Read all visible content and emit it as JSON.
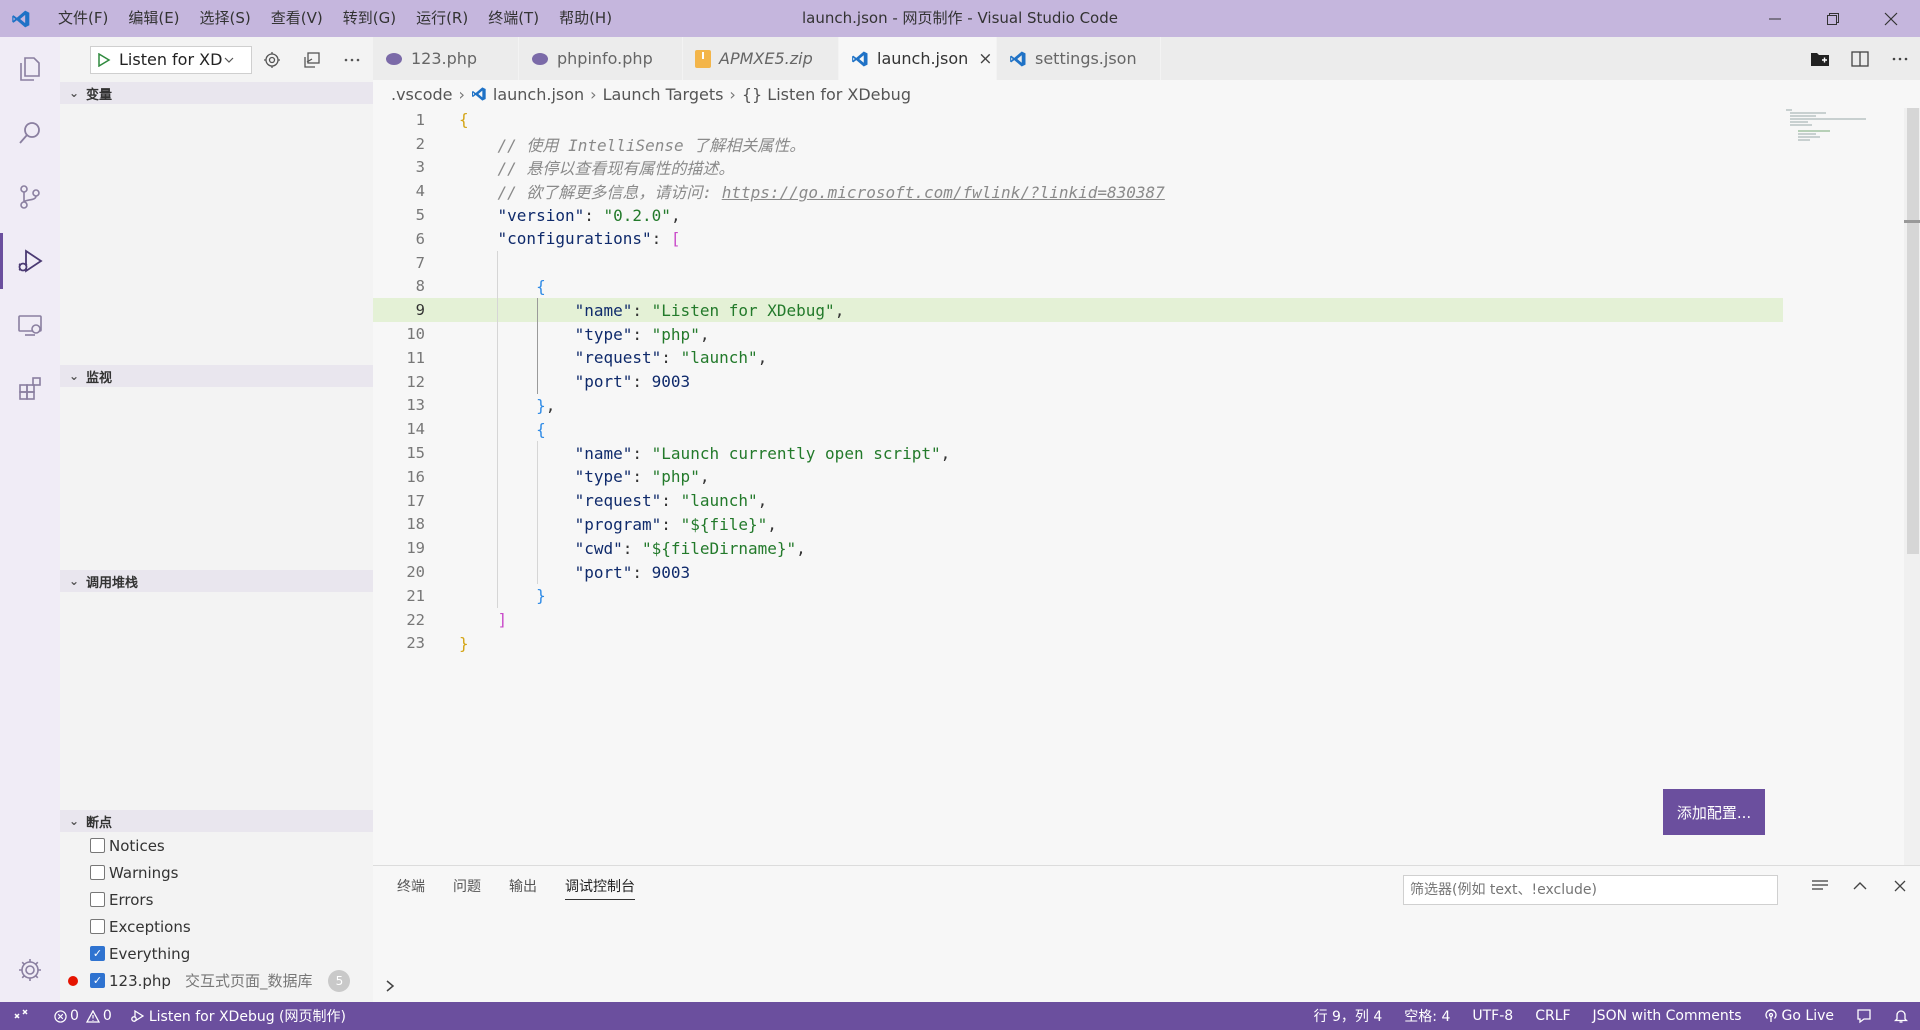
{
  "titlebar": {
    "menus": [
      "文件(F)",
      "编辑(E)",
      "选择(S)",
      "查看(V)",
      "转到(G)",
      "运行(R)",
      "终端(T)",
      "帮助(H)"
    ],
    "window_title": "launch.json - 网页制作 - Visual Studio Code"
  },
  "activitybar": {
    "icons": [
      "explorer-icon",
      "search-icon",
      "source-control-icon",
      "run-debug-icon",
      "remote-explorer-icon",
      "extensions-icon"
    ],
    "active": "run-debug-icon",
    "bottom": "settings-gear-icon"
  },
  "debug_toolbar": {
    "config_label": "Listen for XDe"
  },
  "sidebar": {
    "variables_header": "变量",
    "watch_header": "监视",
    "callstack_header": "调用堆栈",
    "breakpoints_header": "断点",
    "breakpoints": [
      {
        "label": "Notices",
        "checked": false
      },
      {
        "label": "Warnings",
        "checked": false
      },
      {
        "label": "Errors",
        "checked": false
      },
      {
        "label": "Exceptions",
        "checked": false
      },
      {
        "label": "Everything",
        "checked": true
      }
    ],
    "file_breakpoint": {
      "file": "123.php",
      "description": "交互式页面_数据库",
      "count": "5"
    }
  },
  "tabs": [
    {
      "label": "123.php",
      "icon": "php-elephant-icon",
      "active": false
    },
    {
      "label": "phpinfo.php",
      "icon": "php-elephant-icon",
      "active": false
    },
    {
      "label": "APMXE5.zip",
      "icon": "zip-icon",
      "active": false
    },
    {
      "label": "launch.json",
      "icon": "vscode-icon",
      "active": true
    },
    {
      "label": "settings.json",
      "icon": "vscode-icon",
      "active": false
    }
  ],
  "breadcrumb": {
    "folder": ".vscode",
    "file": "launch.json",
    "node1": "Launch Targets",
    "node2": "{} Listen for XDebug"
  },
  "editor": {
    "current_line": 9,
    "lines": [
      "{",
      "    // 使用 IntelliSense 了解相关属性。",
      "    // 悬停以查看现有属性的描述。",
      "    // 欲了解更多信息，请访问: https://go.microsoft.com/fwlink/?linkid=830387",
      "    \"version\": \"0.2.0\",",
      "    \"configurations\": [",
      "",
      "        {",
      "            \"name\": \"Listen for XDebug\",",
      "            \"type\": \"php\",",
      "            \"request\": \"launch\",",
      "            \"port\": 9003",
      "        },",
      "        {",
      "            \"name\": \"Launch currently open script\",",
      "            \"type\": \"php\",",
      "            \"request\": \"launch\",",
      "            \"program\": \"${file}\",",
      "            \"cwd\": \"${fileDirname}\",",
      "            \"port\": 9003",
      "        }",
      "    ]",
      "}"
    ],
    "add_config_button": "添加配置..."
  },
  "panel": {
    "tabs": [
      "终端",
      "问题",
      "输出",
      "调试控制台"
    ],
    "active_tab": "调试控制台",
    "filter_placeholder": "筛选器(例如 text、!exclude)"
  },
  "statusbar": {
    "errors": "0",
    "warnings": "0",
    "debug_session": "Listen for XDebug (网页制作)",
    "position": "行 9，列 4",
    "spaces": "空格: 4",
    "encoding": "UTF-8",
    "eol": "CRLF",
    "language": "JSON with Comments",
    "golive": "Go Live"
  },
  "colors": {
    "accent": "#6b4f9e",
    "titlebar": "#c5b6dd",
    "current_line": "#e4f1d6"
  }
}
